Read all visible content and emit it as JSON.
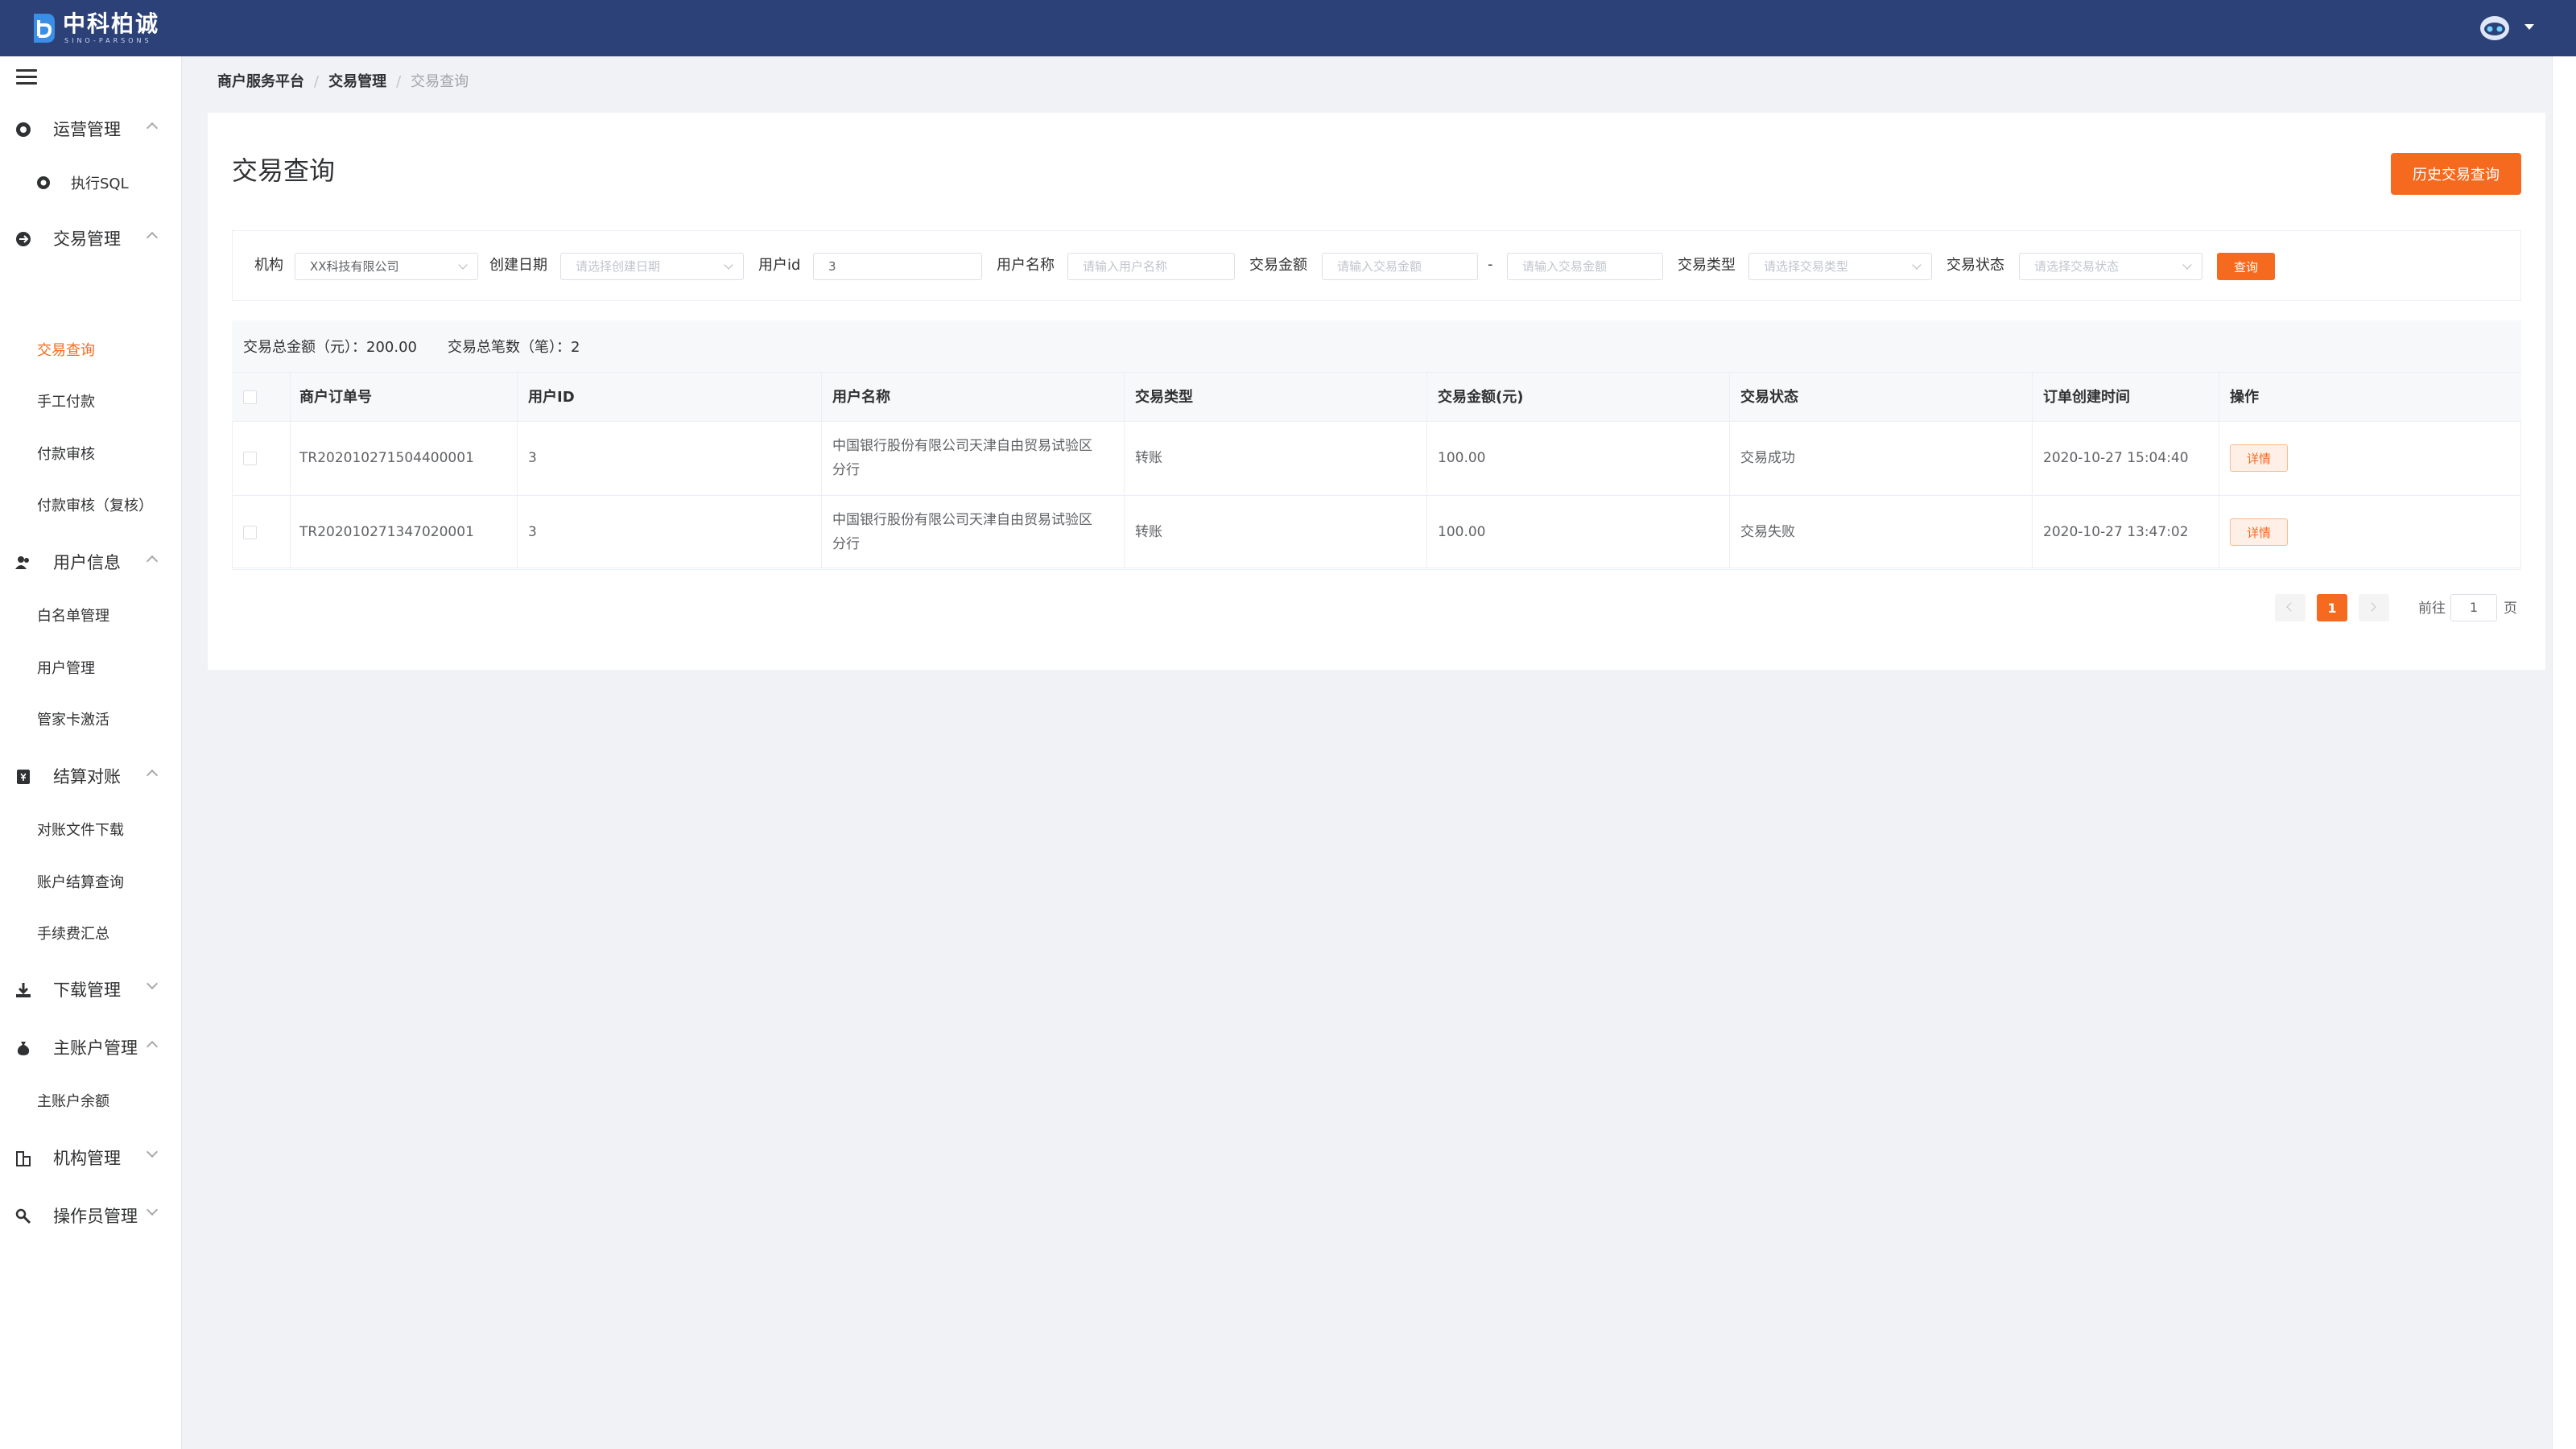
{
  "header": {
    "logo_cn": "中科柏诚",
    "logo_en": "SINO-PARSONS"
  },
  "sidebar": {
    "groups": [
      {
        "label": "运营管理",
        "icon": "gear-icon",
        "items": [
          "执行SQL"
        ]
      },
      {
        "label": "交易管理",
        "icon": "transaction-icon",
        "items": [
          "交易查询",
          "手工付款",
          "付款审核",
          "付款审核（复核）"
        ]
      },
      {
        "label": "用户信息",
        "icon": "users-icon",
        "items": [
          "白名单管理",
          "用户管理",
          "管家卡激活"
        ]
      },
      {
        "label": "结算对账",
        "icon": "settlement-icon",
        "items": [
          "对账文件下载",
          "账户结算查询",
          "手续费汇总"
        ]
      },
      {
        "label": "下载管理",
        "icon": "download-icon",
        "items": []
      },
      {
        "label": "主账户管理",
        "icon": "money-bag-icon",
        "items": [
          "主账户余额"
        ]
      },
      {
        "label": "机构管理",
        "icon": "building-icon",
        "items": []
      },
      {
        "label": "操作员管理",
        "icon": "operator-icon",
        "items": []
      }
    ],
    "active_item": "交易查询"
  },
  "breadcrumb": [
    "商户服务平台",
    "交易管理",
    "交易查询"
  ],
  "page": {
    "title": "交易查询",
    "history_button": "历史交易查询"
  },
  "filters": {
    "org_label": "机构",
    "org_value": "XX科技有限公司",
    "date_label": "创建日期",
    "date_placeholder": "请选择创建日期",
    "userid_label": "用户id",
    "userid_value": "3",
    "username_label": "用户名称",
    "username_placeholder": "请输入用户名称",
    "amount_label": "交易金额",
    "amount_min_placeholder": "请输入交易金额",
    "amount_sep": "-",
    "amount_max_placeholder": "请输入交易金额",
    "type_label": "交易类型",
    "type_placeholder": "请选择交易类型",
    "status_label": "交易状态",
    "status_placeholder": "请选择交易状态",
    "query_button": "查询"
  },
  "summary": {
    "total_amount": "交易总金额（元）：200.00",
    "total_count": "交易总笔数（笔）：2"
  },
  "table": {
    "columns": [
      "商户订单号",
      "用户ID",
      "用户名称",
      "交易类型",
      "交易金额(元)",
      "交易状态",
      "订单创建时间",
      "操作"
    ],
    "rows": [
      {
        "order_no": "TR202010271504400001",
        "user_id": "3",
        "user_name_line1": "中国银行股份有限公司天津自由贸易试验区",
        "user_name_line2": "分行",
        "type": "转账",
        "amount": "100.00",
        "status": "交易成功",
        "created": "2020-10-27 15:04:40",
        "action": "详情"
      },
      {
        "order_no": "TR202010271347020001",
        "user_id": "3",
        "user_name_line1": "中国银行股份有限公司天津自由贸易试验区",
        "user_name_line2": "分行",
        "type": "转账",
        "amount": "100.00",
        "status": "交易失败",
        "created": "2020-10-27 13:47:02",
        "action": "详情"
      }
    ]
  },
  "pagination": {
    "current_page": "1",
    "goto_label": "前往",
    "goto_value": "1",
    "page_suffix": "页"
  },
  "colors": {
    "header_bg": "#2b4178",
    "accent": "#f56a1e"
  }
}
